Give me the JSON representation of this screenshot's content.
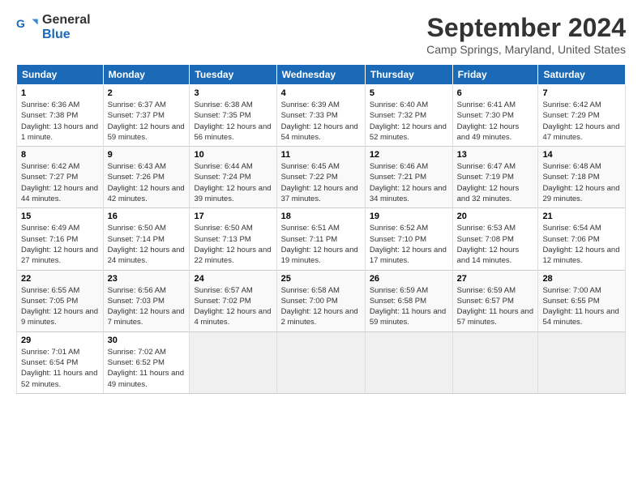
{
  "header": {
    "logo_line1": "General",
    "logo_line2": "Blue",
    "title": "September 2024",
    "subtitle": "Camp Springs, Maryland, United States"
  },
  "days_of_week": [
    "Sunday",
    "Monday",
    "Tuesday",
    "Wednesday",
    "Thursday",
    "Friday",
    "Saturday"
  ],
  "weeks": [
    [
      {
        "num": "1",
        "sunrise": "6:36 AM",
        "sunset": "7:38 PM",
        "daylight": "13 hours and 1 minute."
      },
      {
        "num": "2",
        "sunrise": "6:37 AM",
        "sunset": "7:37 PM",
        "daylight": "12 hours and 59 minutes."
      },
      {
        "num": "3",
        "sunrise": "6:38 AM",
        "sunset": "7:35 PM",
        "daylight": "12 hours and 56 minutes."
      },
      {
        "num": "4",
        "sunrise": "6:39 AM",
        "sunset": "7:33 PM",
        "daylight": "12 hours and 54 minutes."
      },
      {
        "num": "5",
        "sunrise": "6:40 AM",
        "sunset": "7:32 PM",
        "daylight": "12 hours and 52 minutes."
      },
      {
        "num": "6",
        "sunrise": "6:41 AM",
        "sunset": "7:30 PM",
        "daylight": "12 hours and 49 minutes."
      },
      {
        "num": "7",
        "sunrise": "6:42 AM",
        "sunset": "7:29 PM",
        "daylight": "12 hours and 47 minutes."
      }
    ],
    [
      {
        "num": "8",
        "sunrise": "6:42 AM",
        "sunset": "7:27 PM",
        "daylight": "12 hours and 44 minutes."
      },
      {
        "num": "9",
        "sunrise": "6:43 AM",
        "sunset": "7:26 PM",
        "daylight": "12 hours and 42 minutes."
      },
      {
        "num": "10",
        "sunrise": "6:44 AM",
        "sunset": "7:24 PM",
        "daylight": "12 hours and 39 minutes."
      },
      {
        "num": "11",
        "sunrise": "6:45 AM",
        "sunset": "7:22 PM",
        "daylight": "12 hours and 37 minutes."
      },
      {
        "num": "12",
        "sunrise": "6:46 AM",
        "sunset": "7:21 PM",
        "daylight": "12 hours and 34 minutes."
      },
      {
        "num": "13",
        "sunrise": "6:47 AM",
        "sunset": "7:19 PM",
        "daylight": "12 hours and 32 minutes."
      },
      {
        "num": "14",
        "sunrise": "6:48 AM",
        "sunset": "7:18 PM",
        "daylight": "12 hours and 29 minutes."
      }
    ],
    [
      {
        "num": "15",
        "sunrise": "6:49 AM",
        "sunset": "7:16 PM",
        "daylight": "12 hours and 27 minutes."
      },
      {
        "num": "16",
        "sunrise": "6:50 AM",
        "sunset": "7:14 PM",
        "daylight": "12 hours and 24 minutes."
      },
      {
        "num": "17",
        "sunrise": "6:50 AM",
        "sunset": "7:13 PM",
        "daylight": "12 hours and 22 minutes."
      },
      {
        "num": "18",
        "sunrise": "6:51 AM",
        "sunset": "7:11 PM",
        "daylight": "12 hours and 19 minutes."
      },
      {
        "num": "19",
        "sunrise": "6:52 AM",
        "sunset": "7:10 PM",
        "daylight": "12 hours and 17 minutes."
      },
      {
        "num": "20",
        "sunrise": "6:53 AM",
        "sunset": "7:08 PM",
        "daylight": "12 hours and 14 minutes."
      },
      {
        "num": "21",
        "sunrise": "6:54 AM",
        "sunset": "7:06 PM",
        "daylight": "12 hours and 12 minutes."
      }
    ],
    [
      {
        "num": "22",
        "sunrise": "6:55 AM",
        "sunset": "7:05 PM",
        "daylight": "12 hours and 9 minutes."
      },
      {
        "num": "23",
        "sunrise": "6:56 AM",
        "sunset": "7:03 PM",
        "daylight": "12 hours and 7 minutes."
      },
      {
        "num": "24",
        "sunrise": "6:57 AM",
        "sunset": "7:02 PM",
        "daylight": "12 hours and 4 minutes."
      },
      {
        "num": "25",
        "sunrise": "6:58 AM",
        "sunset": "7:00 PM",
        "daylight": "12 hours and 2 minutes."
      },
      {
        "num": "26",
        "sunrise": "6:59 AM",
        "sunset": "6:58 PM",
        "daylight": "11 hours and 59 minutes."
      },
      {
        "num": "27",
        "sunrise": "6:59 AM",
        "sunset": "6:57 PM",
        "daylight": "11 hours and 57 minutes."
      },
      {
        "num": "28",
        "sunrise": "7:00 AM",
        "sunset": "6:55 PM",
        "daylight": "11 hours and 54 minutes."
      }
    ],
    [
      {
        "num": "29",
        "sunrise": "7:01 AM",
        "sunset": "6:54 PM",
        "daylight": "11 hours and 52 minutes."
      },
      {
        "num": "30",
        "sunrise": "7:02 AM",
        "sunset": "6:52 PM",
        "daylight": "11 hours and 49 minutes."
      },
      null,
      null,
      null,
      null,
      null
    ]
  ],
  "label_sunrise": "Sunrise:",
  "label_sunset": "Sunset:",
  "label_daylight": "Daylight:"
}
